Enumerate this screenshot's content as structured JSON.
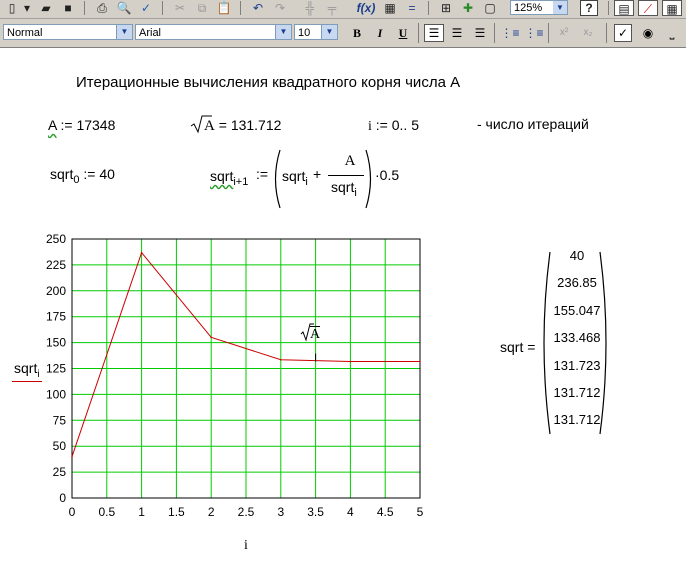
{
  "toolbar": {
    "zoom": "125%",
    "help_label": "?"
  },
  "format_bar": {
    "style": "Normal",
    "font": "Arial",
    "size": "10",
    "bold": "B",
    "italic": "I",
    "underline": "U"
  },
  "document": {
    "title": "Итерационные вычисления квадратного корня числа А",
    "A_def": {
      "var": "A",
      "op": ":=",
      "value": "17348"
    },
    "sqrtA": {
      "radicand": "A",
      "op": "=",
      "value": "131.712"
    },
    "range": {
      "var": "i",
      "op": ":=",
      "value": "0.. 5"
    },
    "range_note": "- число итераций",
    "init": {
      "var": "sqrt",
      "sub": "0",
      "op": ":=",
      "value": "40"
    },
    "iter": {
      "lhs": "sqrt",
      "lhs_sub": "i+1",
      "op": ":=",
      "term1": "sqrt",
      "term1_sub": "i",
      "plus": "+",
      "num": "A",
      "den": "sqrt",
      "den_sub": "i",
      "factor": "·0.5"
    },
    "matrix_label": "sqrt =",
    "matrix_values": [
      "40",
      "236.85",
      "155.047",
      "133.468",
      "131.723",
      "131.712",
      "131.712"
    ]
  },
  "chart_data": {
    "type": "line",
    "x": [
      0,
      1,
      2,
      3,
      4,
      5
    ],
    "series": [
      {
        "name": "sqrt_i",
        "values": [
          40,
          236.85,
          155.047,
          133.468,
          131.723,
          131.712
        ]
      }
    ],
    "xlim": [
      0,
      5
    ],
    "ylim": [
      0,
      250
    ],
    "x_ticks": [
      "0",
      "0.5",
      "1",
      "1.5",
      "2",
      "2.5",
      "3",
      "3.5",
      "4",
      "4.5",
      "5"
    ],
    "y_ticks": [
      "0",
      "25",
      "50",
      "75",
      "100",
      "125",
      "150",
      "175",
      "200",
      "225",
      "250"
    ],
    "xlabel": "i",
    "ylabel": "sqrt",
    "ylabel_sub": "i",
    "annotation": "A",
    "grid": true,
    "colors": {
      "line": "#cc0000",
      "grid": "#00cc00",
      "axes": "#000000"
    }
  }
}
